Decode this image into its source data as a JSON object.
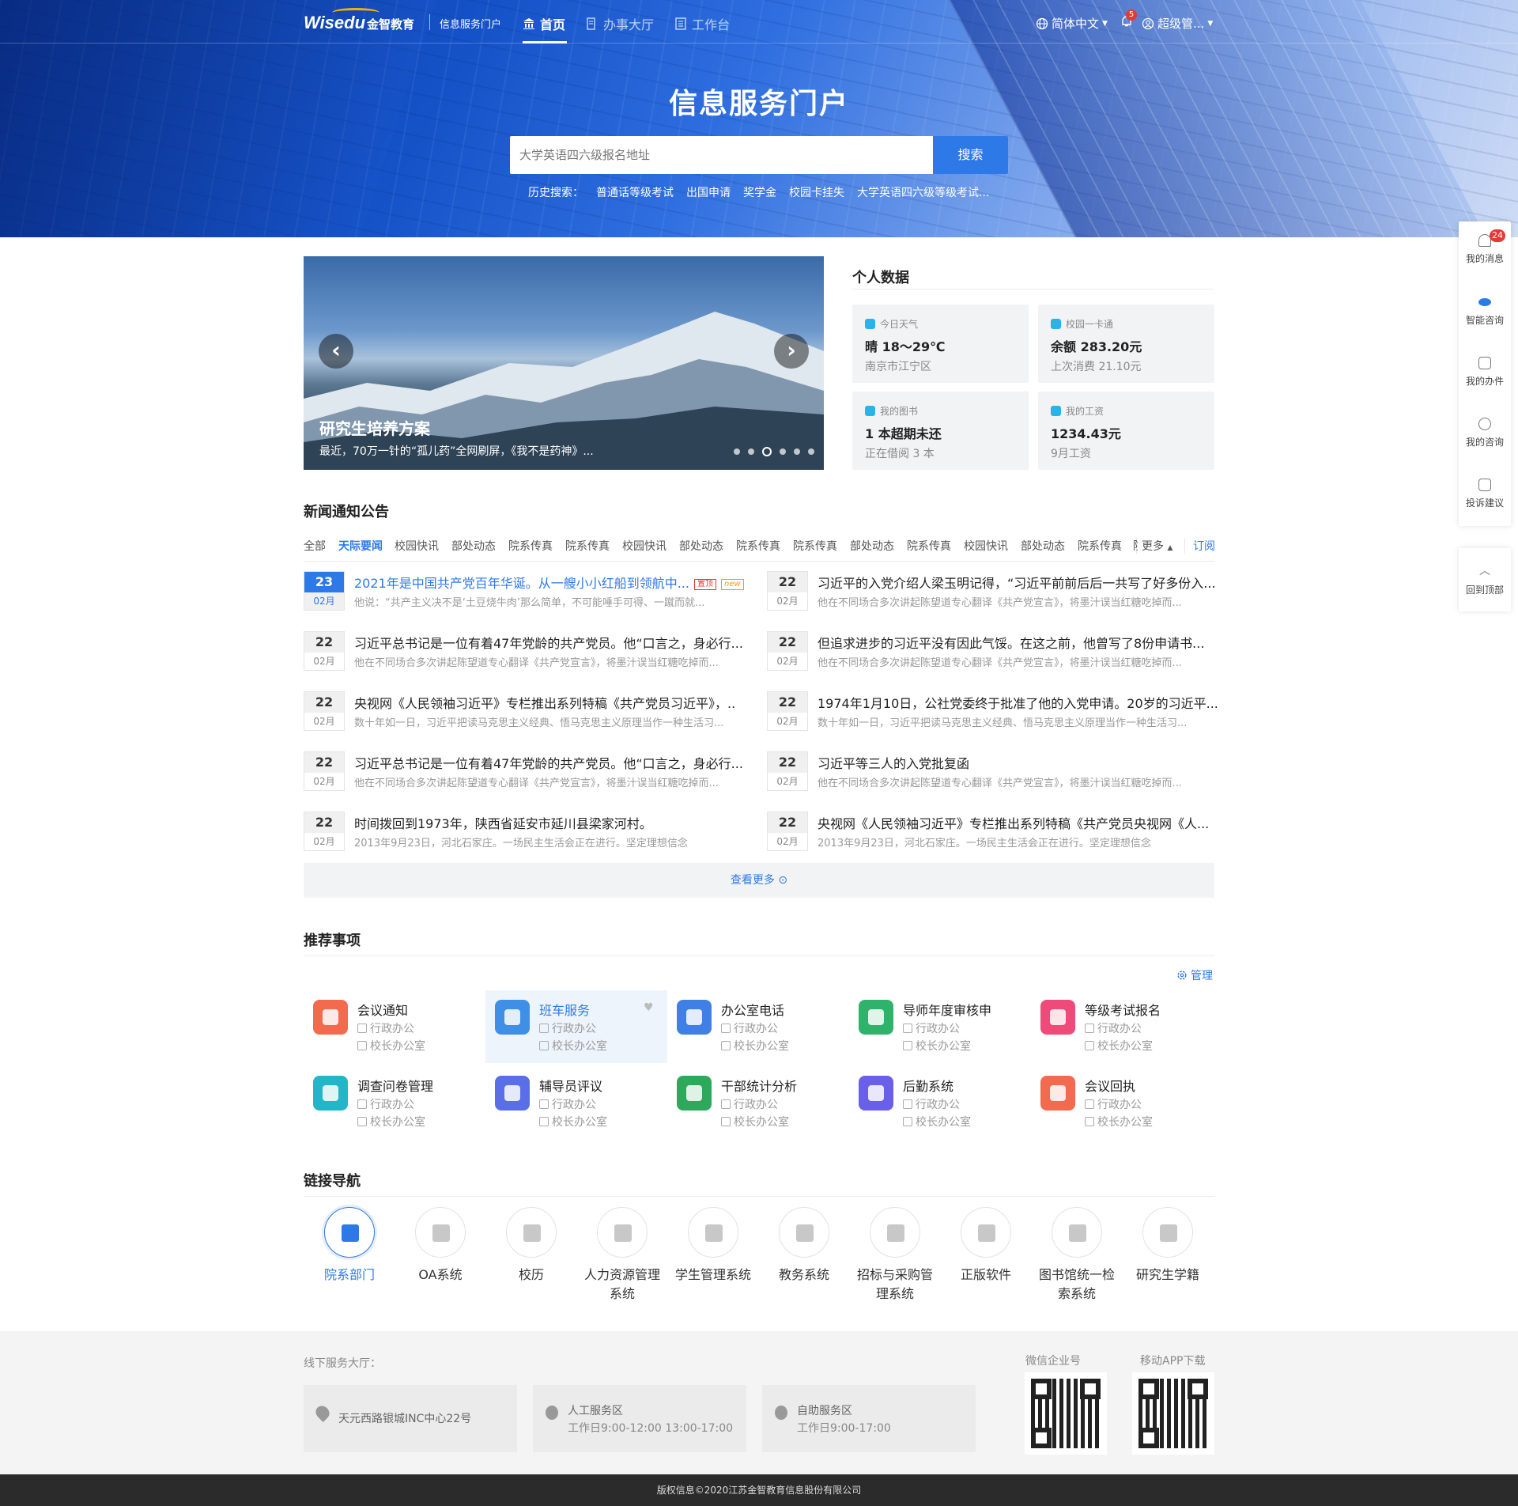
{
  "header": {
    "logo": "Wisedu",
    "logo_cn": "金智教育",
    "portal_name": "信息服务门户",
    "nav": [
      "首页",
      "办事大厅",
      "工作台"
    ],
    "language": "简体中文",
    "notif_count": "5",
    "user": "超级管..."
  },
  "hero": {
    "title": "信息服务门户",
    "search_placeholder": "大学英语四六级报名地址",
    "search_button": "搜索",
    "history_label": "历史搜索：",
    "history": [
      "普通话等级考试",
      "出国申请",
      "奖学金",
      "校园卡挂失",
      "大学英语四六级等级考试..."
    ]
  },
  "carousel": {
    "title": "研究生培养方案",
    "desc": "最近，70万一针的“孤儿药”全网刷屏，《我不是药神》...",
    "prev": "‹",
    "next": "›",
    "active_index": 2
  },
  "personal": {
    "title": "个人数据",
    "cards": [
      {
        "label": "今日天气",
        "value": "晴 18～29℃",
        "sub": "南京市江宁区"
      },
      {
        "label": "校园一卡通",
        "value": "余额 283.20元",
        "sub": "上次消费 21.10元"
      },
      {
        "label": "我的图书",
        "value": "1 本超期未还",
        "sub": "正在借阅 3 本"
      },
      {
        "label": "我的工资",
        "value": "1234.43元",
        "sub": "9月工资"
      }
    ]
  },
  "news": {
    "title": "新闻通知公告",
    "tabs": [
      "全部",
      "天际要闻",
      "校园快讯",
      "部处动态",
      "院系传真",
      "院系传真",
      "校园快讯",
      "部处动态",
      "院系传真",
      "院系传真",
      "部处动态",
      "院系传真",
      "校园快讯",
      "部处动态",
      "院系传真",
      "院"
    ],
    "more_tab": "更多",
    "subscribe": "订阅",
    "items": [
      {
        "day": "23",
        "month": "02月",
        "title": "2021年是中国共产党百年华诞。从一艘小小红船到领航中...",
        "desc": "他说：“共产主义决不是‘土豆烧牛肉’那么简单，不可能唾手可得、一蹴而就...",
        "tag_top": "置顶",
        "tag_new": "new"
      },
      {
        "day": "22",
        "month": "02月",
        "title": "习近平的入党介绍人梁玉明记得，“习近平前前后后一共写了好多份入...",
        "desc": "他在不同场合多次讲起陈望道专心翻译《共产党宣言》，将墨汁误当红糖吃掉而..."
      },
      {
        "day": "22",
        "month": "02月",
        "title": "习近平总书记是一位有着47年党龄的共产党员。他“口言之，身必行...",
        "desc": "他在不同场合多次讲起陈望道专心翻译《共产党宣言》，将墨汁误当红糖吃掉而..."
      },
      {
        "day": "22",
        "month": "02月",
        "title": "但追求进步的习近平没有因此气馁。在这之前，他曾写了8份申请书...",
        "desc": "他在不同场合多次讲起陈望道专心翻译《共产党宣言》，将墨汁误当红糖吃掉而..."
      },
      {
        "day": "22",
        "month": "02月",
        "title": "央视网《人民领袖习近平》专栏推出系列特稿《共产党员习近平》，..",
        "desc": "数十年如一日，习近平把读马克思主义经典、悟马克思主义原理当作一种生活习..."
      },
      {
        "day": "22",
        "month": "02月",
        "title": "1974年1月10日，公社党委终于批准了他的入党申请。20岁的习近平...",
        "desc": "数十年如一日，习近平把读马克思主义经典、悟马克思主义原理当作一种生活习..."
      },
      {
        "day": "22",
        "month": "02月",
        "title": "习近平总书记是一位有着47年党龄的共产党员。他“口言之，身必行...",
        "desc": "他在不同场合多次讲起陈望道专心翻译《共产党宣言》，将墨汁误当红糖吃掉而..."
      },
      {
        "day": "22",
        "month": "02月",
        "title": "习近平等三人的入党批复函",
        "desc": "他在不同场合多次讲起陈望道专心翻译《共产党宣言》，将墨汁误当红糖吃掉而..."
      },
      {
        "day": "22",
        "month": "02月",
        "title": "时间拨回到1973年，陕西省延安市延川县梁家河村。",
        "desc": "2013年9月23日，河北石家庄。一场民主生活会正在进行。坚定理想信念"
      },
      {
        "day": "22",
        "month": "02月",
        "title": "央视网《人民领袖习近平》专栏推出系列特稿《共产党员央视网《人...",
        "desc": "2013年9月23日，河北石家庄。一场民主生活会正在进行。坚定理想信念"
      }
    ],
    "view_more": "查看更多 ⊙"
  },
  "recommend": {
    "title": "推荐事项",
    "manage": "管理",
    "items": [
      {
        "name": "会议通知",
        "dept": "行政办公",
        "office": "校长办公室",
        "color": "#f26b4f"
      },
      {
        "name": "班车服务",
        "dept": "行政办公",
        "office": "校长办公室",
        "color": "#3f8fe6"
      },
      {
        "name": "办公室电话",
        "dept": "行政办公",
        "office": "校长办公室",
        "color": "#3f7fe6"
      },
      {
        "name": "导师年度审核申",
        "dept": "行政办公",
        "office": "校长办公室",
        "color": "#2fb36a"
      },
      {
        "name": "等级考试报名",
        "dept": "行政办公",
        "office": "校长办公室",
        "color": "#ee4b7a"
      },
      {
        "name": "调查问卷管理",
        "dept": "行政办公",
        "office": "校长办公室",
        "color": "#23b6c8"
      },
      {
        "name": "辅导员评议",
        "dept": "行政办公",
        "office": "校长办公室",
        "color": "#5a6ee8"
      },
      {
        "name": "干部统计分析",
        "dept": "行政办公",
        "office": "校长办公室",
        "color": "#2ea85a"
      },
      {
        "name": "后勤系统",
        "dept": "行政办公",
        "office": "校长办公室",
        "color": "#6a5fe8"
      },
      {
        "name": "会议回执",
        "dept": "行政办公",
        "office": "校长办公室",
        "color": "#f26b4f"
      }
    ]
  },
  "links": {
    "title": "链接导航",
    "items": [
      "院系部门",
      "OA系统",
      "校历",
      "人力资源管理系统",
      "学生管理系统",
      "教务系统",
      "招标与采购管理系统",
      "正版软件",
      "图书馆统一检索系统",
      "研究生学籍"
    ]
  },
  "footer": {
    "offline_label": "线下服务大厅：",
    "addr1": "天元西路银城INC中心22号",
    "hall2_name": "人工服务区",
    "hall2_time": "工作日9:00-12:00 13:00-17:00",
    "hall3_name": "自助服务区",
    "hall3_time": "工作日9:00-17:00",
    "qr1_label": "微信企业号",
    "qr2_label": "移动APP下载",
    "copyright": "版权信息©2020江苏金智教育信息股份有限公司"
  },
  "side": {
    "items": [
      "我的消息",
      "智能咨询",
      "我的办件",
      "我的咨询",
      "投诉建议"
    ],
    "msg_count": "24",
    "back_top": "回到顶部"
  }
}
